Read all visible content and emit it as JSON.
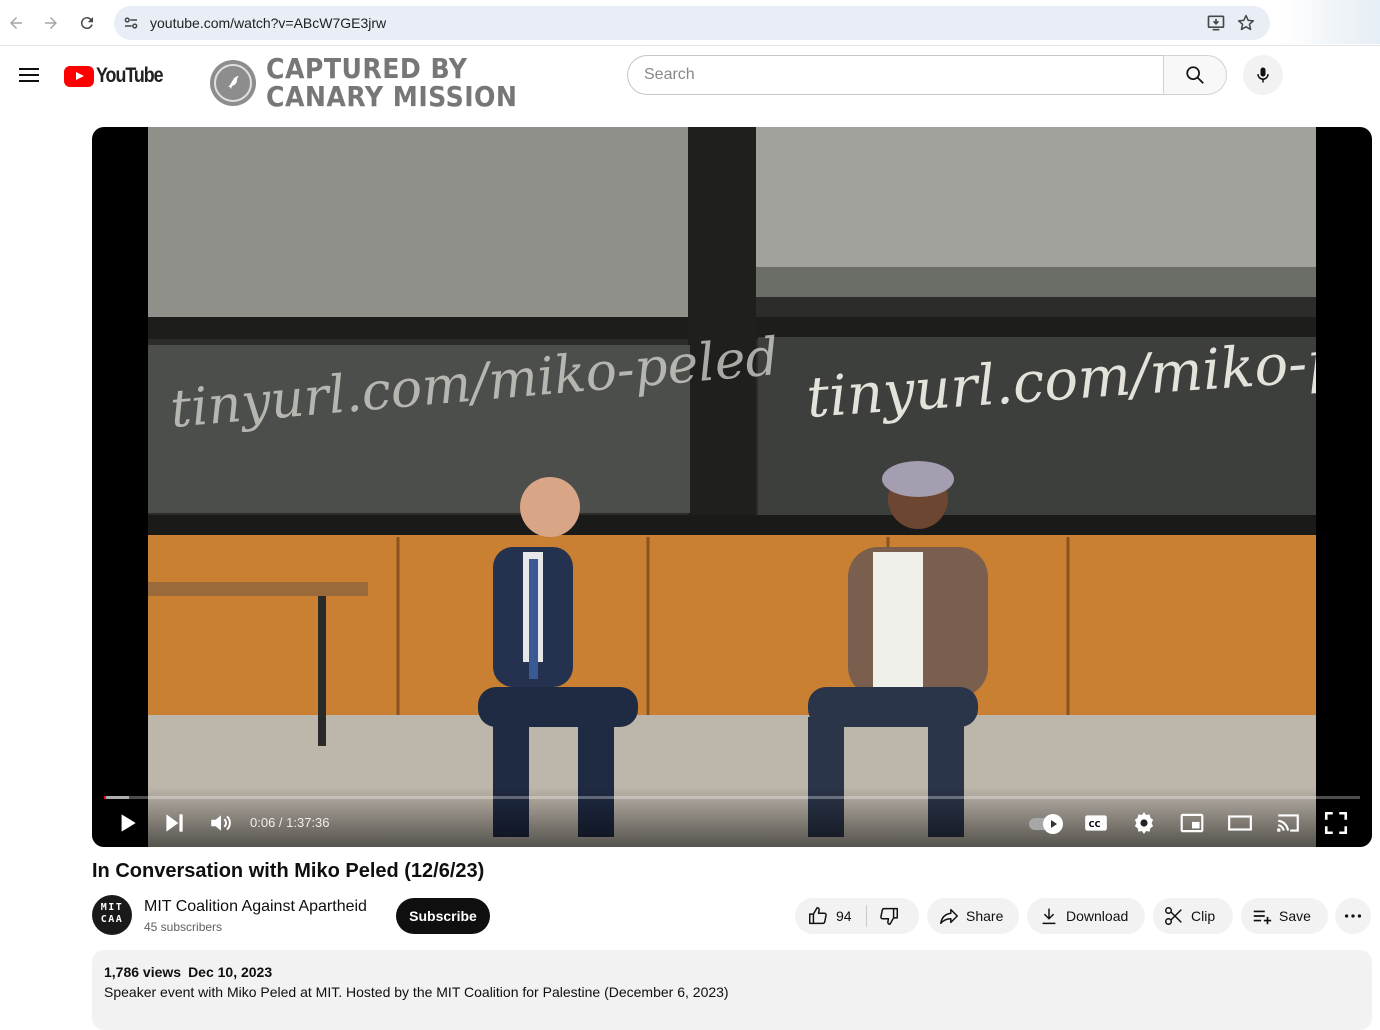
{
  "browser": {
    "url": "youtube.com/watch?v=ABcW7GE3jrw"
  },
  "masthead": {
    "logo_text": "YouTube",
    "watermark": {
      "line1": "CAPTURED BY",
      "line2": "CANARY MISSION"
    },
    "search_placeholder": "Search"
  },
  "player": {
    "chalk_left": "tinyurl.com/miko-peled",
    "chalk_right": "tinyurl.com/miko-peled",
    "time": "0:06 / 1:37:36",
    "progress_fraction": 0.001,
    "buffered_fraction": 0.02
  },
  "video": {
    "title": "In Conversation with Miko Peled (12/6/23)"
  },
  "channel": {
    "avatar_line1": "MIT",
    "avatar_line2": "CAA",
    "name": "MIT Coalition Against Apartheid",
    "subscribers": "45 subscribers",
    "subscribe_label": "Subscribe"
  },
  "actions": {
    "likes": "94",
    "share": "Share",
    "download": "Download",
    "clip": "Clip",
    "save": "Save"
  },
  "description": {
    "views": "1,786 views",
    "date": "Dec 10, 2023",
    "text": "Speaker event with Miko Peled at MIT. Hosted by the MIT Coalition for Palestine (December 6, 2023)"
  },
  "colors": {
    "brand_red": "#ff0000",
    "chip_bg": "#f2f2f2",
    "subscribe_bg": "#0f0f0f"
  }
}
